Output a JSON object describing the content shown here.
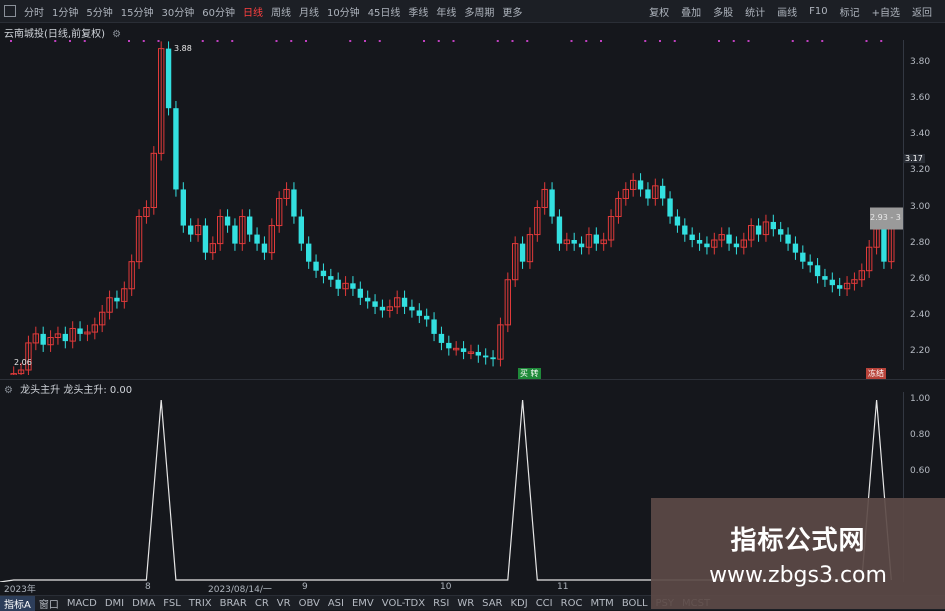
{
  "toolbar": {
    "left_icon": "□",
    "periods": [
      "分时",
      "1分钟",
      "5分钟",
      "15分钟",
      "30分钟",
      "60分钟",
      "日线",
      "周线",
      "月线",
      "10分钟",
      "45日线",
      "季线",
      "年线",
      "多周期",
      "更多"
    ],
    "active_period": "日线",
    "right_items": [
      "复权",
      "叠加",
      "多股",
      "统计",
      "画线",
      "F10",
      "标记",
      "+自选",
      "返回"
    ]
  },
  "chart_title": "云南城投(日线,前复权)",
  "colors": {
    "up": "#e03a3a",
    "down": "#33e0e0",
    "bg": "#15171c",
    "marker": "#c040c0"
  },
  "y_axis_main": [
    "3.80",
    "3.60",
    "3.40",
    "3.20",
    "3.00",
    "2.80",
    "2.60",
    "2.40",
    "2.20"
  ],
  "annotations": {
    "high": "3.88",
    "low": "2.06",
    "last": "3.17",
    "current": "2.93 - 3",
    "buy_badge": "买 转",
    "sell_badge": "冻结"
  },
  "indicator": {
    "title": "龙头主升  龙头主升: 0.00",
    "y_axis": [
      "1.00",
      "0.80",
      "0.60"
    ]
  },
  "x_axis": [
    "2023年",
    "8",
    "2023/08/14/一",
    "9",
    "10",
    "11"
  ],
  "bottom_tabs": [
    "指标A",
    "窗口",
    "MACD",
    "DMI",
    "DMA",
    "FSL",
    "TRIX",
    "BRAR",
    "CR",
    "VR",
    "OBV",
    "ASI",
    "EMV",
    "VOL-TDX",
    "RSI",
    "WR",
    "SAR",
    "KDJ",
    "CCI",
    "ROC",
    "MTM",
    "BOLL",
    "PSY",
    "MCST"
  ],
  "watermark": {
    "title": "指标公式网",
    "url": "www.zbgs3.com"
  },
  "chart_data": {
    "type": "candlestick",
    "title": "云南城投(日线,前复权)",
    "ylim": [
      2.06,
      3.9
    ],
    "closes": [
      2.08,
      2.1,
      2.25,
      2.3,
      2.24,
      2.28,
      2.3,
      2.26,
      2.33,
      2.3,
      2.31,
      2.35,
      2.42,
      2.5,
      2.48,
      2.55,
      2.7,
      2.95,
      3.0,
      3.3,
      3.88,
      3.55,
      3.1,
      2.9,
      2.85,
      2.9,
      2.75,
      2.8,
      2.95,
      2.9,
      2.8,
      2.95,
      2.85,
      2.8,
      2.75,
      2.9,
      3.05,
      3.1,
      2.95,
      2.8,
      2.7,
      2.65,
      2.62,
      2.6,
      2.55,
      2.58,
      2.55,
      2.5,
      2.48,
      2.45,
      2.43,
      2.45,
      2.5,
      2.45,
      2.43,
      2.4,
      2.38,
      2.3,
      2.25,
      2.22,
      2.22,
      2.2,
      2.2,
      2.18,
      2.17,
      2.16,
      2.35,
      2.6,
      2.8,
      2.7,
      2.85,
      3.0,
      3.1,
      2.95,
      2.8,
      2.82,
      2.8,
      2.78,
      2.85,
      2.8,
      2.82,
      2.95,
      3.05,
      3.1,
      3.15,
      3.1,
      3.05,
      3.12,
      3.05,
      2.95,
      2.9,
      2.85,
      2.82,
      2.8,
      2.78,
      2.82,
      2.85,
      2.8,
      2.78,
      2.82,
      2.9,
      2.85,
      2.92,
      2.88,
      2.85,
      2.8,
      2.75,
      2.7,
      2.68,
      2.62,
      2.6,
      2.57,
      2.55,
      2.58,
      2.6,
      2.65,
      2.78,
      2.88,
      2.7,
      2.93
    ],
    "indicator_signal": {
      "values_at": [
        20,
        69,
        117
      ],
      "value": 1.0
    }
  }
}
